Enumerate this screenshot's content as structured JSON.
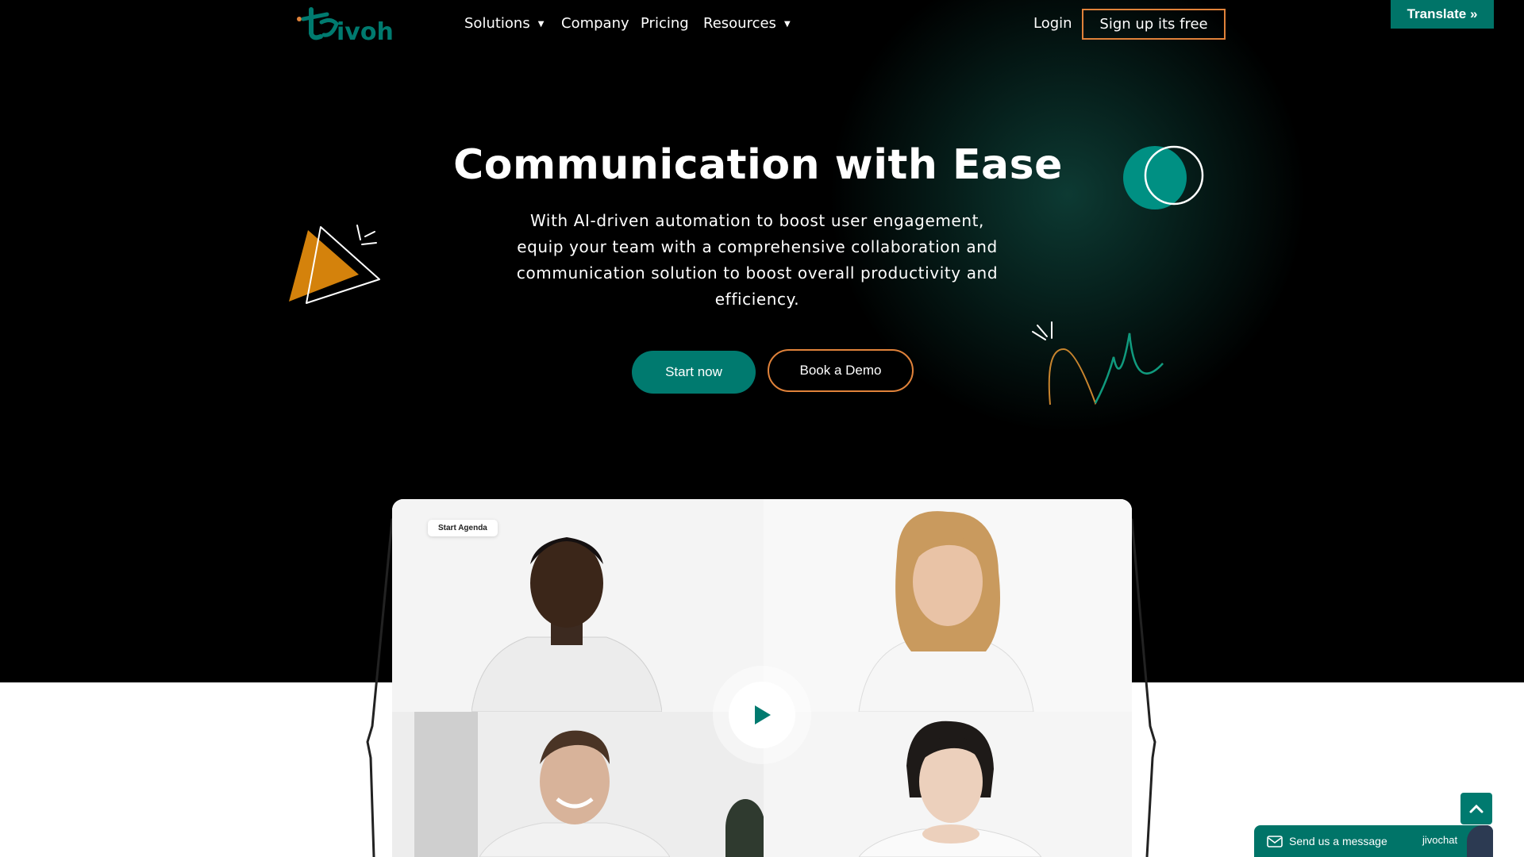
{
  "nav": {
    "logo_text": "tivoh",
    "items": [
      {
        "label": "Solutions",
        "has_dropdown": true
      },
      {
        "label": "Company",
        "has_dropdown": false
      },
      {
        "label": "Pricing",
        "has_dropdown": false
      },
      {
        "label": "Resources",
        "has_dropdown": true
      }
    ],
    "login": "Login",
    "signup": "Sign up its free",
    "translate": "Translate »"
  },
  "hero": {
    "title": "Communication with Ease",
    "subtitle": "With AI-driven automation to boost user engagement, equip your team with a comprehensive collaboration and communication solution to boost overall productivity and efficiency.",
    "start_button": "Start now",
    "demo_button": "Book a Demo"
  },
  "video": {
    "agenda_label": "Start Agenda",
    "play_icon": "play-icon"
  },
  "widgets": {
    "chat_label": "Send us a message",
    "chat_brand": "jivochat",
    "scroll_top_icon": "chevron-up-icon"
  },
  "colors": {
    "brand_teal": "#007a6f",
    "accent_orange": "#e0823a",
    "hero_bg": "#000000"
  }
}
